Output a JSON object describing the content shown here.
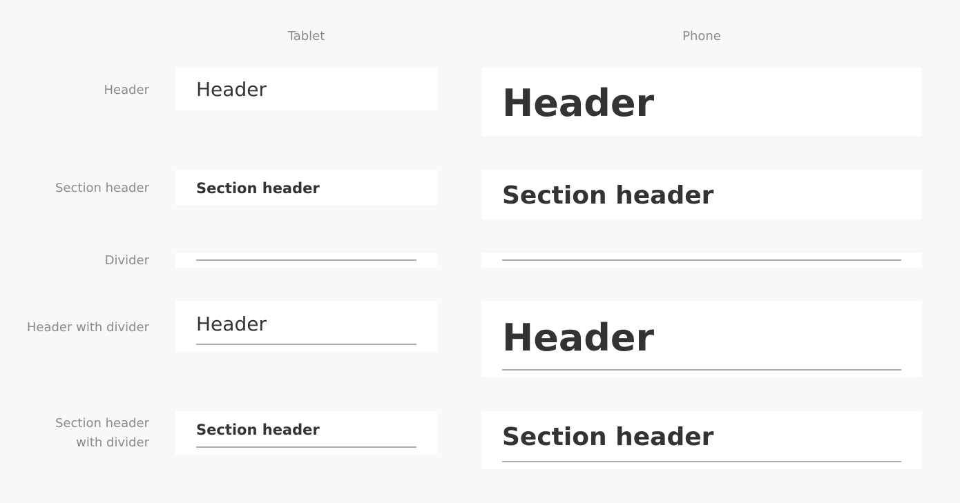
{
  "columns": {
    "tablet": "Tablet",
    "phone": "Phone"
  },
  "rows": {
    "header": {
      "label": "Header",
      "tablet_title": "Header",
      "phone_title": "Header"
    },
    "section_header": {
      "label": "Section header",
      "tablet_title": "Section header",
      "phone_title": "Section header"
    },
    "divider": {
      "label": "Divider"
    },
    "header_with_divider": {
      "label": "Header with divider",
      "tablet_title": "Header",
      "phone_title": "Header"
    },
    "section_header_with_divider": {
      "label_line1": "Section header",
      "label_line2": "with divider",
      "tablet_title": "Section header",
      "phone_title": "Section header"
    }
  },
  "colors": {
    "page_background": "#f8f8f8",
    "card_background": "#ffffff",
    "label_text": "#8a8a8a",
    "title_text": "#333333",
    "divider": "#ababab"
  }
}
